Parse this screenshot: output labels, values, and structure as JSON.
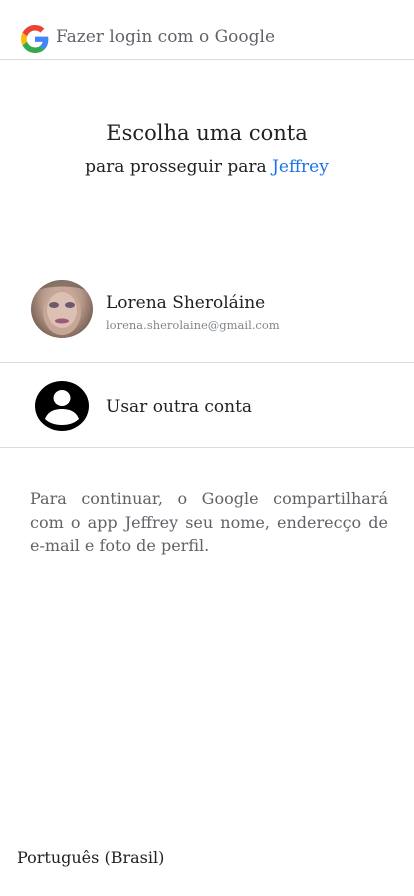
{
  "header": {
    "title": "Fazer login com o Google",
    "logo_icon": "google-g-icon"
  },
  "main": {
    "heading": "Escolha uma conta",
    "subheading_prefix": "para prosseguir para ",
    "app_name": "Jeffrey"
  },
  "accounts": [
    {
      "name": "Lorena Sheroláine",
      "email": "lorena.sherolaine@gmail.com",
      "avatar": "profile-photo"
    }
  ],
  "other_account": {
    "label": "Usar outra conta",
    "icon": "account-circle-icon"
  },
  "consent_text": "Para continuar, o Google compartilhará com o app Jeffrey seu nome, enderecço de e-mail e foto de perfil.",
  "footer": {
    "language": "Português (Brasil)"
  },
  "colors": {
    "link": "#1a73e8",
    "divider": "#dadce0",
    "secondary_text": "#5f6368"
  }
}
